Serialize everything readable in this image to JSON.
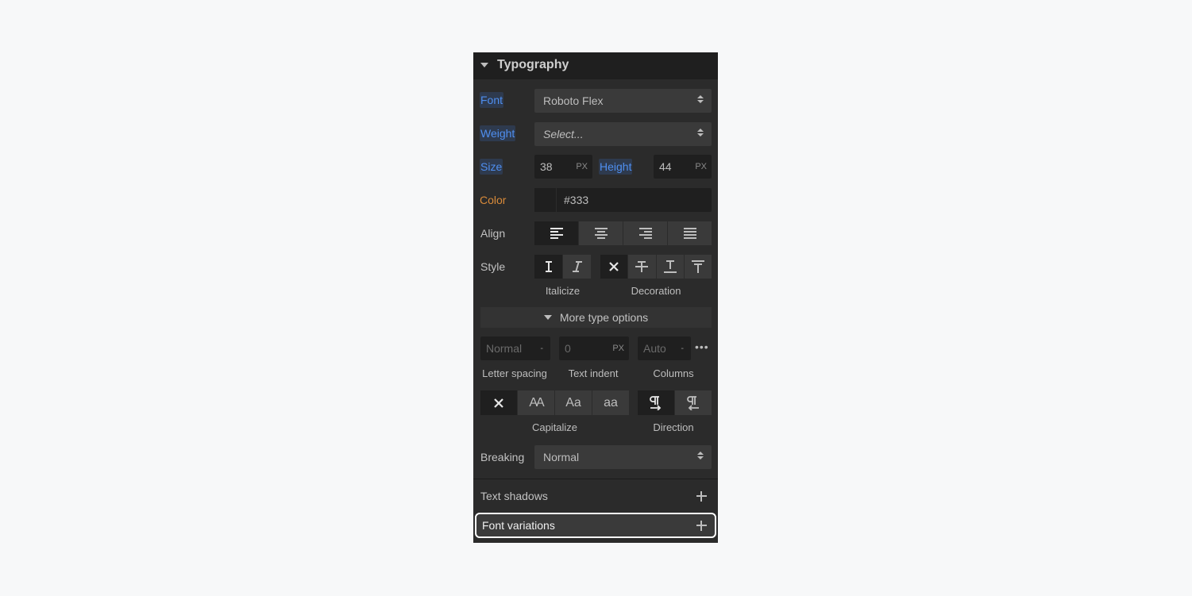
{
  "panel": {
    "title": "Typography",
    "icons": {
      "collapse": "triangle-down-icon"
    },
    "colors": {
      "panel_bg": "#2b2b2b",
      "header_bg": "#1f1f1f",
      "set_label": "#4f8ff0",
      "inherited_label": "#d98b3a",
      "focus_outline": "#ffffff"
    }
  },
  "font": {
    "label": "Font",
    "value": "Roboto Flex"
  },
  "weight": {
    "label": "Weight",
    "placeholder": "Select..."
  },
  "size": {
    "label": "Size",
    "value": "38",
    "unit": "PX"
  },
  "height": {
    "label": "Height",
    "value": "44",
    "unit": "PX"
  },
  "color": {
    "label": "Color",
    "value": "#333"
  },
  "align": {
    "label": "Align",
    "options": [
      "left",
      "center",
      "right",
      "justify"
    ],
    "selected": "left"
  },
  "style": {
    "label": "Style",
    "italicize_caption": "Italicize",
    "decoration_caption": "Decoration",
    "italicize_options": [
      "regular",
      "italic"
    ],
    "italicize_selected": "regular",
    "decoration_options": [
      "none",
      "strikethrough",
      "underline",
      "overline"
    ],
    "decoration_selected": "none"
  },
  "more_type_options": {
    "label": "More type options"
  },
  "letter_spacing": {
    "placeholder": "Normal",
    "unit": "-",
    "caption": "Letter spacing"
  },
  "text_indent": {
    "placeholder": "0",
    "unit": "PX",
    "caption": "Text indent"
  },
  "columns": {
    "placeholder": "Auto",
    "unit": "-",
    "caption": "Columns",
    "more_icon": "more-dots-icon"
  },
  "capitalize": {
    "caption": "Capitalize",
    "options": [
      {
        "id": "none",
        "text": ""
      },
      {
        "id": "uppercase",
        "text": "AA"
      },
      {
        "id": "capitalize",
        "text": "Aa"
      },
      {
        "id": "lowercase",
        "text": "aa"
      }
    ],
    "selected": "none"
  },
  "direction": {
    "caption": "Direction",
    "options": [
      "ltr",
      "rtl"
    ],
    "selected": "ltr"
  },
  "breaking": {
    "label": "Breaking",
    "value": "Normal"
  },
  "text_shadows": {
    "label": "Text shadows"
  },
  "font_variations": {
    "label": "Font variations"
  }
}
